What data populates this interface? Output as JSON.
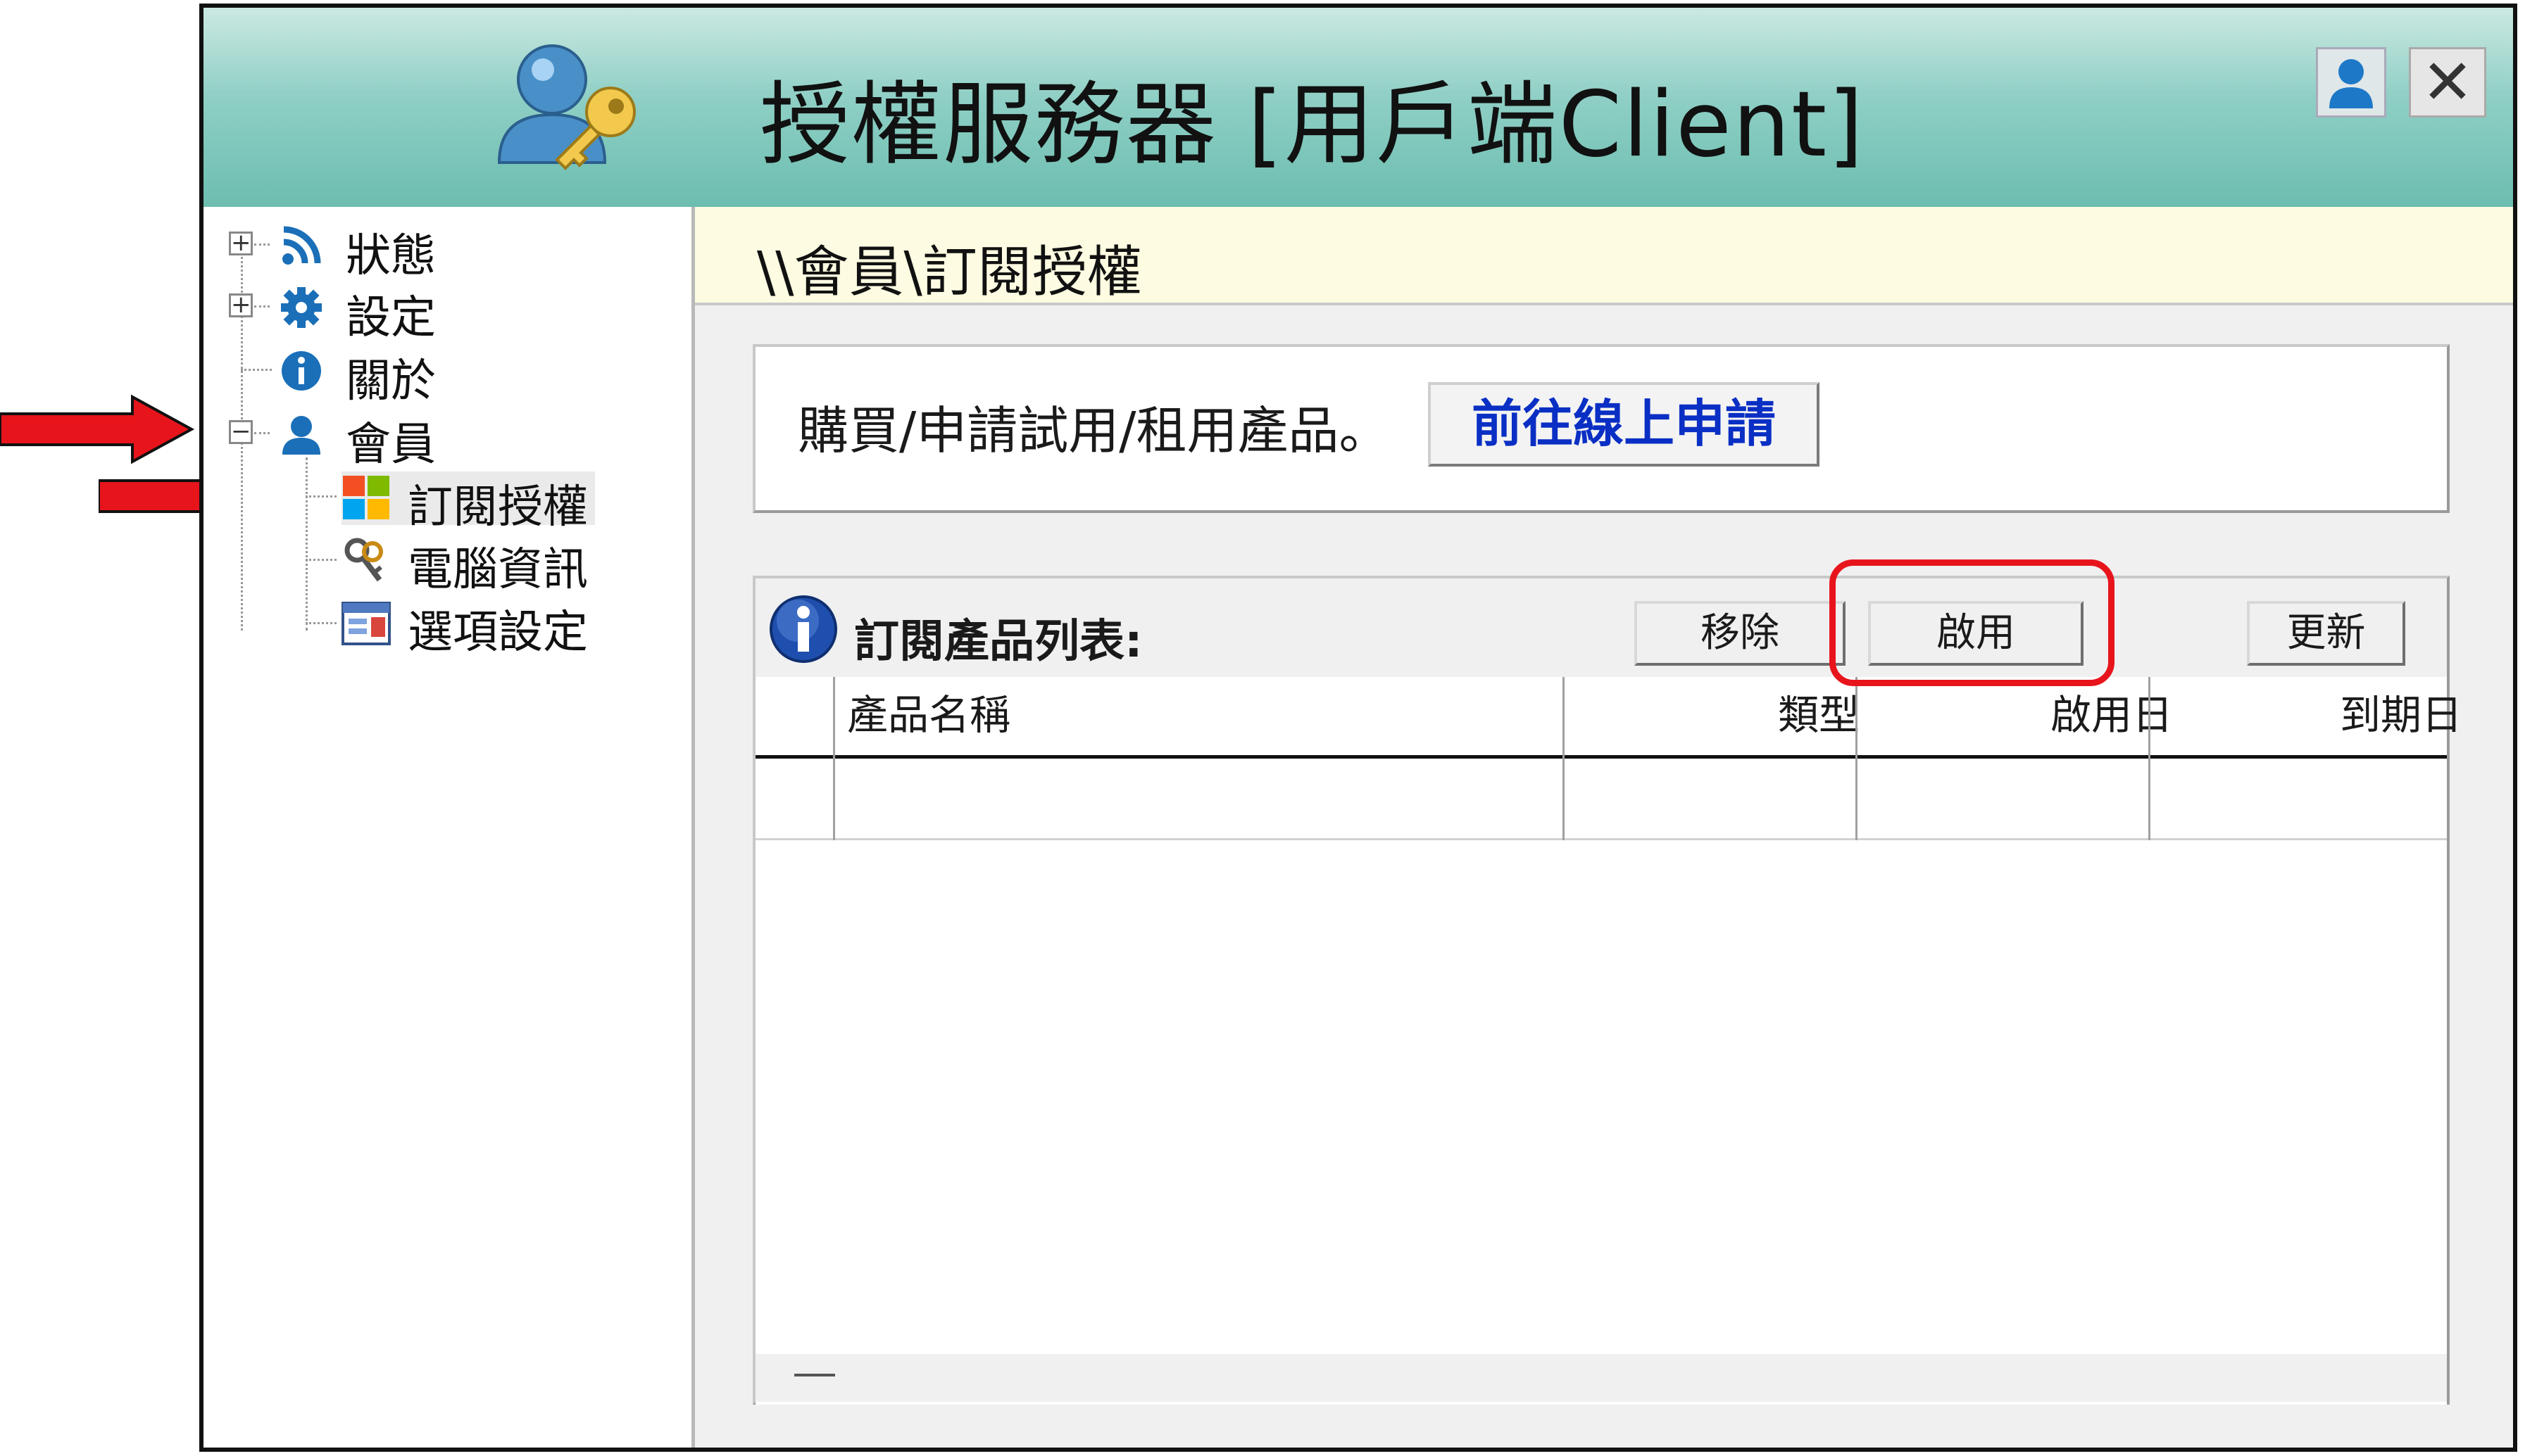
{
  "window": {
    "title": "授權服務器  [用戶端Client]",
    "close_glyph": "✕",
    "user_icon": "user-icon",
    "logo_icon": "user-key-icon"
  },
  "tree": {
    "items": [
      {
        "label": "狀態",
        "icon": "rss-icon",
        "expander": "+"
      },
      {
        "label": "設定",
        "icon": "gear-icon",
        "expander": "+"
      },
      {
        "label": "關於",
        "icon": "info-icon"
      },
      {
        "label": "會員",
        "icon": "member-icon",
        "expander": "−"
      },
      {
        "label": "訂閱授權",
        "icon": "windows-logo-icon"
      },
      {
        "label": "電腦資訊",
        "icon": "key-icon"
      },
      {
        "label": "選項設定",
        "icon": "settings-form-icon"
      }
    ]
  },
  "breadcrumb": "\\\\會員\\訂閱授權",
  "purchase": {
    "text": "購買/申請試用/租用產品。",
    "button_label": "前往線上申請"
  },
  "subscriptions": {
    "title": "訂閱產品列表:",
    "remove_label": "移除",
    "enable_label": "啟用",
    "refresh_label": "更新",
    "columns": [
      "產品名稱",
      "類型",
      "啟用日",
      "到期日"
    ],
    "rows": []
  },
  "colors": {
    "annotation_red": "#e8141c",
    "link_blue": "#0a2fc4",
    "breadcrumb_bg": "#fdfbe1",
    "titlebar": "#8fcfc5"
  }
}
